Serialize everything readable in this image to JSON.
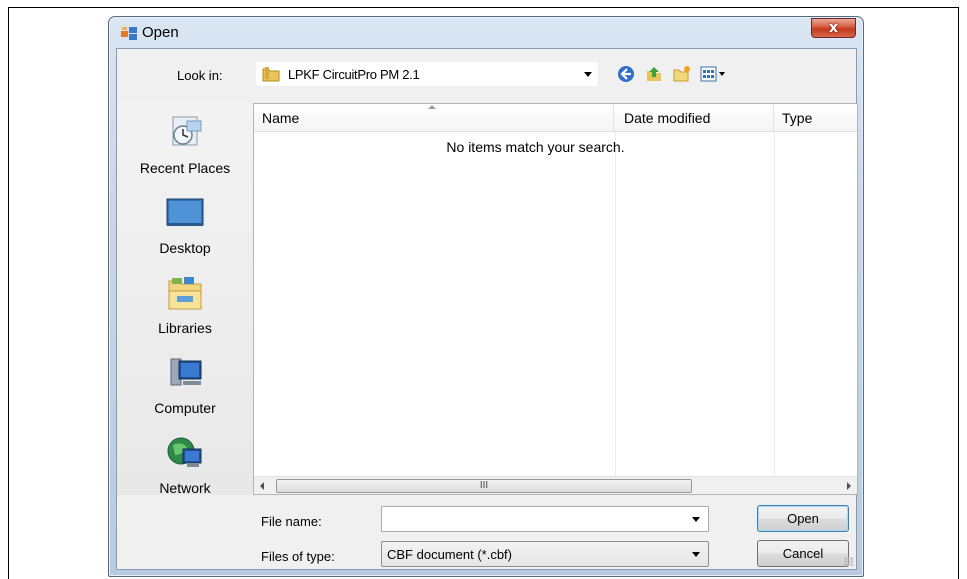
{
  "window": {
    "title": "Open",
    "close_glyph": "x"
  },
  "toolbar": {
    "look_in_label": "Look in:",
    "look_in_value": "LPKF CircuitPro PM 2.1",
    "buttons": [
      "back-icon",
      "up-folder-icon",
      "new-folder-icon",
      "view-menu-icon"
    ]
  },
  "places": [
    {
      "label": "Recent Places",
      "icon": "recent-places-icon"
    },
    {
      "label": "Desktop",
      "icon": "desktop-icon"
    },
    {
      "label": "Libraries",
      "icon": "libraries-icon"
    },
    {
      "label": "Computer",
      "icon": "computer-icon"
    },
    {
      "label": "Network",
      "icon": "network-icon"
    }
  ],
  "filelist": {
    "columns": [
      "Name",
      "Date modified",
      "Type"
    ],
    "empty_message": "No items match your search.",
    "scroll_thumb_grip": "III"
  },
  "form": {
    "file_name_label": "File name:",
    "file_name_value": "",
    "files_of_type_label": "Files of type:",
    "files_of_type_value": "CBF document (*.cbf)"
  },
  "buttons": {
    "open": "Open",
    "cancel": "Cancel"
  },
  "colors": {
    "title_gradient_top": "#dbe6f3",
    "close_button": "#c33a1e",
    "client_bg": "#f0f0f0",
    "default_button_border": "#3c7fb1"
  }
}
